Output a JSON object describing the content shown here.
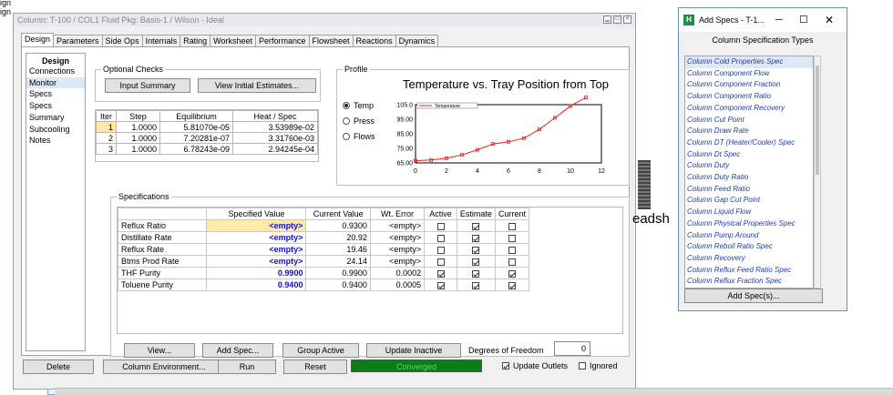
{
  "background": {
    "left_text_1": "ign",
    "left_text_2": "ign",
    "partial_text": "eadsh"
  },
  "window": {
    "title": "Column: T-100 / COL1  Fluid Pkg: Basis-1 / Wilson - Ideal",
    "tabs": [
      "Design",
      "Parameters",
      "Side Ops",
      "Internals",
      "Rating",
      "Worksheet",
      "Performance",
      "Flowsheet",
      "Reactions",
      "Dynamics"
    ],
    "active_tab": "Design"
  },
  "nav": {
    "header": "Design",
    "items": [
      "Connections",
      "Monitor",
      "Specs",
      "Specs Summary",
      "Subcooling",
      "Notes"
    ],
    "selected": "Monitor"
  },
  "optional_checks": {
    "title": "Optional Checks",
    "input_summary_label": "Input Summary",
    "view_initial_label": "View Initial Estimates...",
    "columns": [
      "Iter",
      "Step",
      "Equilibrium",
      "Heat / Spec"
    ],
    "rows": [
      [
        "1",
        "1.0000",
        "5.81070e-05",
        "3.53989e-02"
      ],
      [
        "2",
        "1.0000",
        "7.20281e-07",
        "3.31760e-03"
      ],
      [
        "3",
        "1.0000",
        "6.78243e-09",
        "2.94245e-04"
      ]
    ]
  },
  "profile": {
    "title": "Profile",
    "options": [
      "Temp",
      "Press",
      "Flows"
    ],
    "selected": "Temp"
  },
  "chart_data": {
    "type": "line",
    "title": "Temperature vs. Tray Position from Top",
    "legend": [
      "Temperature"
    ],
    "legend_position": "top-left",
    "x": [
      0,
      1,
      2,
      3,
      4,
      5,
      6,
      7,
      8,
      9,
      10,
      11
    ],
    "series": [
      {
        "name": "Temperature",
        "values": [
          66.5,
          67,
          68.2,
          70.5,
          74,
          78,
          79.5,
          82,
          88,
          96,
          104,
          110
        ]
      }
    ],
    "xlim": [
      0,
      12
    ],
    "ylim": [
      65,
      105
    ],
    "x_ticks": [
      0,
      2,
      4,
      6,
      8,
      10,
      12
    ],
    "y_ticks": [
      "65.00",
      "75.00",
      "85.00",
      "95.00",
      "105.0"
    ],
    "grid": true,
    "color": "#e02020"
  },
  "specifications": {
    "title": "Specifications",
    "columns": [
      "",
      "Specified Value",
      "Current Value",
      "Wt. Error",
      "Active",
      "Estimate",
      "Current"
    ],
    "rows": [
      {
        "name": "Reflux Ratio",
        "specified": "<empty>",
        "current": "0.9300",
        "wt_error": "<empty>",
        "active": false,
        "estimate": true,
        "curr": false
      },
      {
        "name": "Distillate Rate",
        "specified": "<empty>",
        "current": "20.92",
        "wt_error": "<empty>",
        "active": false,
        "estimate": true,
        "curr": false
      },
      {
        "name": "Reflux Rate",
        "specified": "<empty>",
        "current": "19.46",
        "wt_error": "<empty>",
        "active": false,
        "estimate": true,
        "curr": false
      },
      {
        "name": "Btms Prod Rate",
        "specified": "<empty>",
        "current": "24.14",
        "wt_error": "<empty>",
        "active": false,
        "estimate": true,
        "curr": false
      },
      {
        "name": "THF Purity",
        "specified": "0.9900",
        "current": "0.9900",
        "wt_error": "0.0002",
        "active": true,
        "estimate": true,
        "curr": true
      },
      {
        "name": "Toluene Purity",
        "specified": "0.9400",
        "current": "0.9400",
        "wt_error": "0.0005",
        "active": true,
        "estimate": true,
        "curr": true
      }
    ],
    "buttons": {
      "view": "View...",
      "add_spec": "Add Spec...",
      "group_active": "Group Active",
      "update_inactive": "Update Inactive"
    },
    "dof_label": "Degrees of Freedom",
    "dof_value": "0"
  },
  "bottom_bar": {
    "delete": "Delete",
    "column_env": "Column Environment...",
    "run": "Run",
    "reset": "Reset",
    "status": "Converged",
    "update_outlets": "Update Outlets",
    "update_outlets_checked": true,
    "ignored": "Ignored",
    "ignored_checked": false
  },
  "popup": {
    "title": "Add Specs - T-1...",
    "icon_letter": "H",
    "header": "Column Specification Types",
    "items": [
      "Column Cold Properties Spec",
      "Column Component Flow",
      "Column Component Fraction",
      "Column Component Ratio",
      "Column Component Recovery",
      "Column Cut Point",
      "Column Draw Rate",
      "Column DT (Heater/Cooler) Spec",
      "Column Dt Spec",
      "Column Duty",
      "Column Duty Ratio",
      "Column Feed Ratio",
      "Column Gap Cut Point",
      "Column Liquid Flow",
      "Column Physical Properties Spec",
      "Column Pump Around",
      "Column Reboil Ratio Spec",
      "Column Recovery",
      "Column Reflux Feed Ratio Spec",
      "Column Reflux Fraction Spec"
    ],
    "selected_index": 0,
    "add_button": "Add Spec(s)..."
  }
}
